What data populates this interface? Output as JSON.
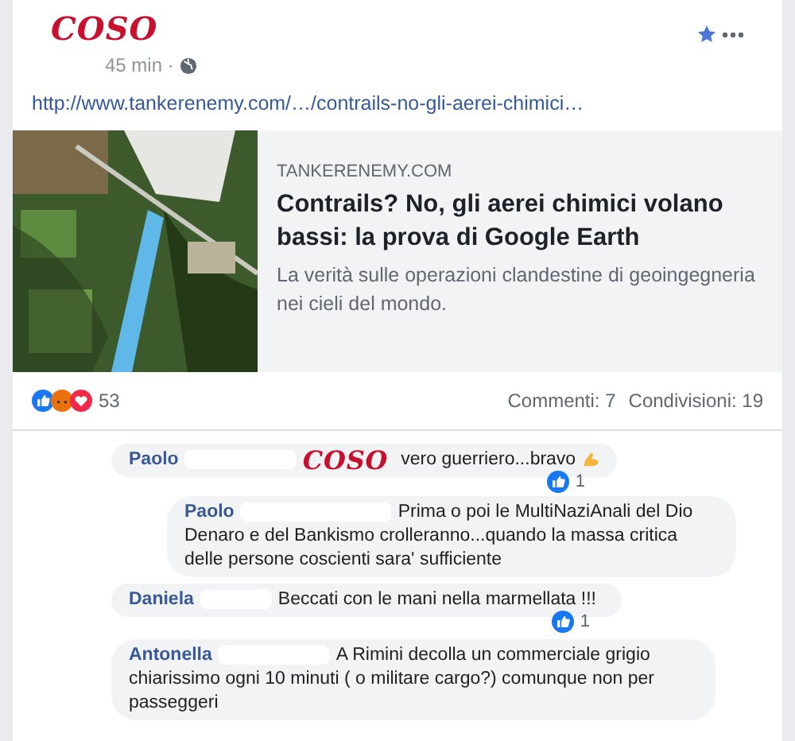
{
  "post": {
    "author": "COSO",
    "time": "45 min ·",
    "link": "http://www.tankerenemy.com/…/contrails-no-gli-aerei-chimici…"
  },
  "preview": {
    "site": "TANKERENEMY.COM",
    "title": "Contrails? No, gli aerei chimici volano bassi: la prova di Google Earth",
    "description": "La verità sulle operazioni clandestine di geoingegneria nei cieli del mondo."
  },
  "reactions": {
    "count": "53",
    "comments": "Commenti: 7",
    "shares": "Condivisioni: 19"
  },
  "comments": [
    {
      "author": "Paolo",
      "tag": "COSO",
      "text": "vero guerriero...bravo",
      "emoji": true,
      "likes": "1",
      "children": [
        {
          "author": "Paolo",
          "text": "Prima o poi le MultiNaziAnali del Dio Denaro e del Bankismo crolleranno...quando la massa critica delle persone coscienti sara' sufficiente"
        }
      ]
    },
    {
      "author": "Daniela",
      "text": "Beccati con le mani nella marmellata !!!",
      "likes": "1"
    },
    {
      "author": "Antonella",
      "text": "A Rimini decolla un commerciale grigio chiarissimo ogni 10 minuti ( o militare cargo?) comunque non per passeggeri"
    }
  ]
}
